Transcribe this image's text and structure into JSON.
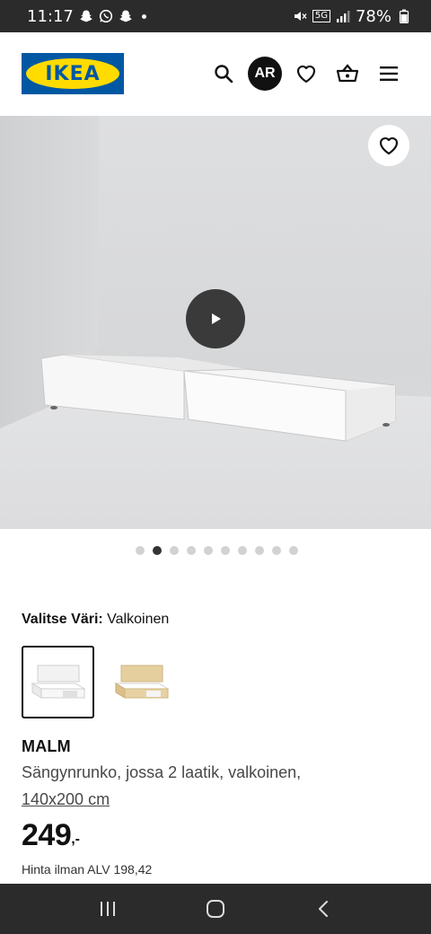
{
  "status_bar": {
    "time": "11:17",
    "network": "5G",
    "battery": "78%"
  },
  "header": {
    "logo_text": "IKEA",
    "language_badge": "AR",
    "icons": [
      "search-icon",
      "language-badge",
      "heart-icon",
      "basket-icon",
      "menu-icon"
    ]
  },
  "gallery": {
    "total_images": 10,
    "active_index": 1
  },
  "color_picker": {
    "label": "Valitse Väri:",
    "selected_value": "Valkoinen",
    "options": [
      "Valkoinen",
      "Tammiviilu"
    ]
  },
  "product": {
    "name": "MALM",
    "description": "Sängynrunko, jossa 2 laatik, valkoinen,",
    "size": "140x200 cm",
    "price": "249",
    "price_suffix": ",-",
    "vat_text": "Hinta ilman ALV 198,42"
  },
  "colors": {
    "ikea_blue": "#0058a3",
    "ikea_yellow": "#ffdb00",
    "status_bar_bg": "#2b2b2b"
  }
}
